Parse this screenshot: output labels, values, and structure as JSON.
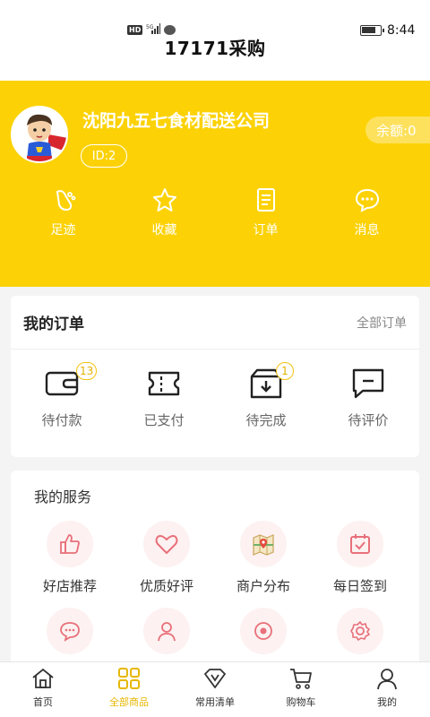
{
  "status": {
    "hd": "HD",
    "network": "5G",
    "time": "8:44"
  },
  "app_title": "17171采购",
  "profile": {
    "company": "沈阳九五七食材配送公司",
    "id_label": "ID:2",
    "balance_label": "余额:0"
  },
  "quick_links": [
    {
      "label": "足迹",
      "icon": "footprint-icon"
    },
    {
      "label": "收藏",
      "icon": "star-icon"
    },
    {
      "label": "订单",
      "icon": "order-doc-icon"
    },
    {
      "label": "消息",
      "icon": "message-icon"
    }
  ],
  "orders": {
    "title": "我的订单",
    "all_link": "全部订单",
    "items": [
      {
        "label": "待付款",
        "badge": "13",
        "icon": "wallet-icon"
      },
      {
        "label": "已支付",
        "badge": "",
        "icon": "ticket-icon"
      },
      {
        "label": "待完成",
        "badge": "1",
        "icon": "box-download-icon"
      },
      {
        "label": "待评价",
        "badge": "",
        "icon": "comment-icon"
      }
    ]
  },
  "services": {
    "title": "我的服务",
    "items": [
      {
        "label": "好店推荐",
        "icon": "thumbs-up-icon"
      },
      {
        "label": "优质好评",
        "icon": "heart-icon"
      },
      {
        "label": "商户分布",
        "icon": "map-icon"
      },
      {
        "label": "每日签到",
        "icon": "calendar-check-icon"
      }
    ]
  },
  "tabbar": {
    "items": [
      {
        "label": "首页",
        "icon": "home-icon"
      },
      {
        "label": "全部商品",
        "icon": "grid-icon",
        "active": true
      },
      {
        "label": "常用清单",
        "icon": "v-diamond-icon"
      },
      {
        "label": "购物车",
        "icon": "cart-icon"
      },
      {
        "label": "我的",
        "icon": "user-icon"
      }
    ]
  },
  "colors": {
    "brand_yellow": "#fcd206",
    "badge_yellow": "#e3b100",
    "service_pink": "#e8707a"
  }
}
